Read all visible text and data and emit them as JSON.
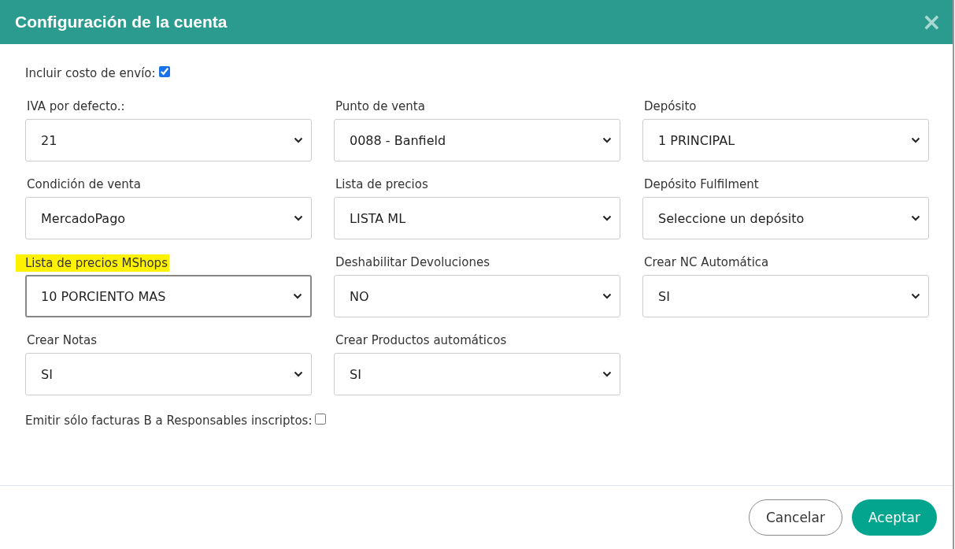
{
  "dialog": {
    "title": "Configuración de la cuenta",
    "close": "×"
  },
  "top_checkbox": {
    "label": "Incluir costo de envío:",
    "checked": true
  },
  "fields": [
    {
      "label": "IVA por defecto.:",
      "value": "21",
      "highlighted": false,
      "focused": false
    },
    {
      "label": "Punto de venta",
      "value": "0088 - Banfield",
      "highlighted": false,
      "focused": false
    },
    {
      "label": "Depósito",
      "value": "1 PRINCIPAL",
      "highlighted": false,
      "focused": false
    },
    {
      "label": "Condición de venta",
      "value": "MercadoPago",
      "highlighted": false,
      "focused": false
    },
    {
      "label": "Lista de precios",
      "value": "LISTA ML",
      "highlighted": false,
      "focused": false
    },
    {
      "label": "Depósito Fulfilment",
      "value": "Seleccione un depósito",
      "highlighted": false,
      "focused": false
    },
    {
      "label": "Lista de precios MShops",
      "value": "10 PORCIENTO MAS",
      "highlighted": true,
      "focused": true
    },
    {
      "label": "Deshabilitar Devoluciones",
      "value": "NO",
      "highlighted": false,
      "focused": false
    },
    {
      "label": "Crear NC Automática",
      "value": "SI",
      "highlighted": false,
      "focused": false
    },
    {
      "label": "Crear Notas",
      "value": "SI",
      "highlighted": false,
      "focused": false
    },
    {
      "label": "Crear Productos automáticos",
      "value": "SI",
      "highlighted": false,
      "focused": false
    }
  ],
  "bottom_checkbox": {
    "label": "Emitir sólo facturas B a Responsables inscriptos:",
    "checked": false
  },
  "buttons": [
    {
      "label": "Cancelar",
      "kind": "secondary"
    },
    {
      "label": "Aceptar",
      "kind": "primary"
    }
  ]
}
